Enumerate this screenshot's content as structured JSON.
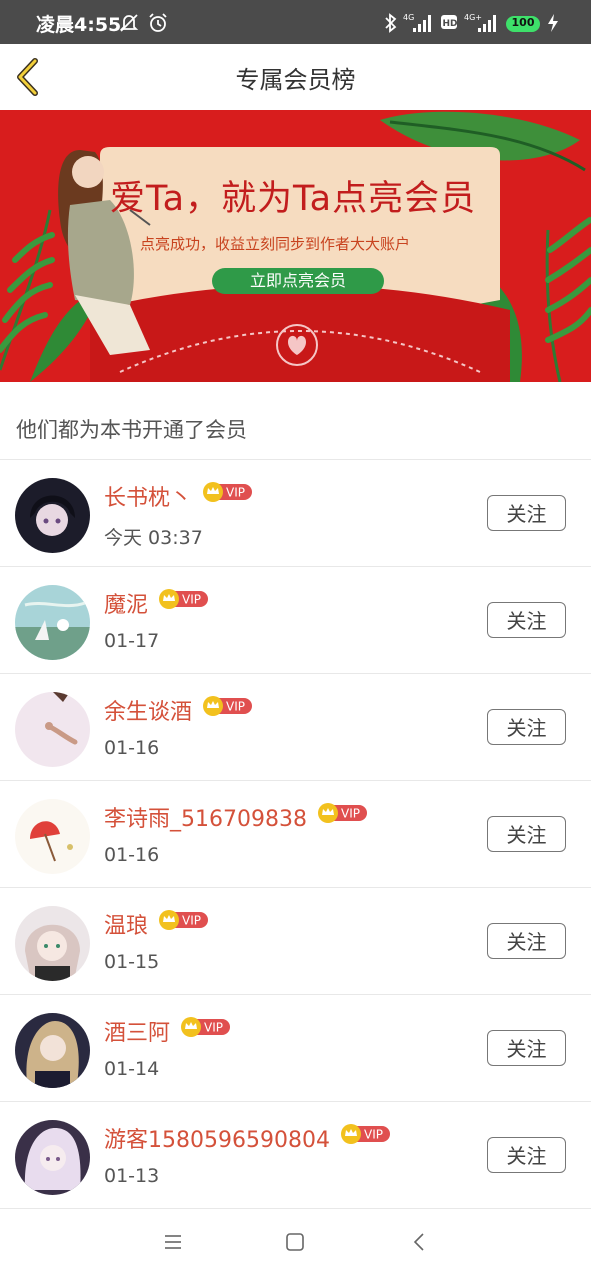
{
  "status": {
    "time": "凌晨4:55",
    "battery": "100"
  },
  "header": {
    "title": "专属会员榜"
  },
  "banner": {
    "title": "爱Ta，就为Ta点亮会员",
    "subtitle": "点亮成功，收益立刻同步到作者大大账户",
    "button": "立即点亮会员"
  },
  "section_title": "他们都为本书开通了会员",
  "vip_label": "VIP",
  "follow_label": "关注",
  "members": [
    {
      "name": "长书枕丶",
      "time": "今天 03:37"
    },
    {
      "name": "魔泥",
      "time": "01-17"
    },
    {
      "name": "余生谈酒",
      "time": "01-16"
    },
    {
      "name": "李诗雨_516709838",
      "time": "01-16"
    },
    {
      "name": "温琅",
      "time": "01-15"
    },
    {
      "name": "酒三阿",
      "time": "01-14"
    },
    {
      "name": "游客1580596590804",
      "time": "01-13"
    }
  ]
}
